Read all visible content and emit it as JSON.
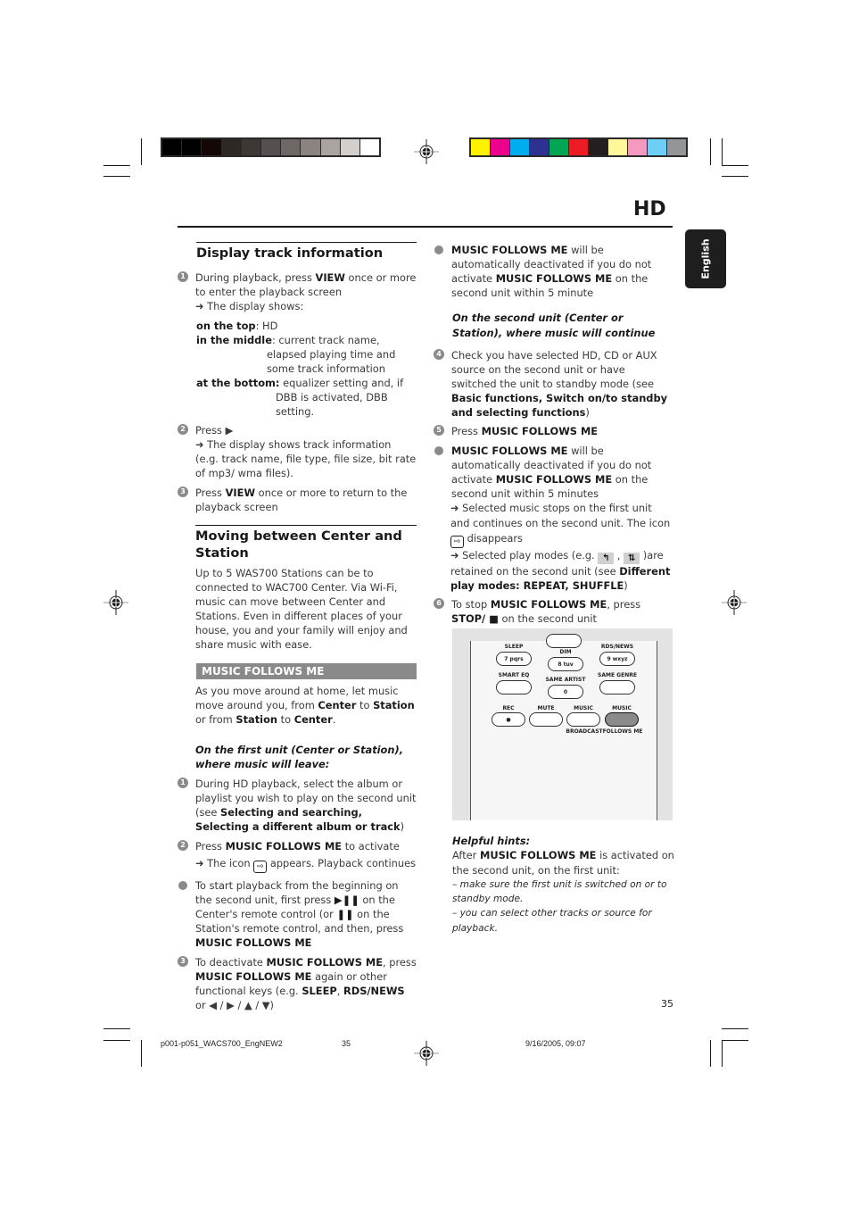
{
  "print_marks": {
    "grayscale_swatches": [
      "#000000",
      "#000000",
      "#140807",
      "#2d2826",
      "#3d3835",
      "#555050",
      "#6f6765",
      "#8b8380",
      "#a9a4a1",
      "#d3cfcd",
      "#ffffff"
    ],
    "color_swatches": [
      "#fff200",
      "#ec008c",
      "#00aeef",
      "#2e3192",
      "#00a651",
      "#ed1c24",
      "#231f20",
      "#fff799",
      "#f49ac1",
      "#6dcff6",
      "#939598"
    ]
  },
  "header": {
    "section_code": "HD",
    "language_tab": "English"
  },
  "left_column": {
    "display_track": {
      "heading": "Display track information",
      "step1": {
        "num": "1",
        "pre": "During playback, press ",
        "key": "VIEW",
        "post": " once or more to enter the playback screen",
        "result": "➜ The display shows:"
      },
      "on_top_label": "on the top",
      "on_top_value": ": HD",
      "middle_label": "in the middle",
      "middle_value": ": current track name, elapsed playing time and some track information",
      "bottom_label": "at the bottom:",
      "bottom_value": " equalizer setting and, if DBB is activated, DBB setting.",
      "step2": {
        "num": "2",
        "text": "Press ▶",
        "result": "➜ The display shows track information (e.g. track name, file type, file size, bit rate of mp3/ wma files)."
      },
      "step3": {
        "num": "3",
        "pre": "Press ",
        "key": "VIEW",
        "post": " once or more to return to the playback screen"
      }
    },
    "moving": {
      "heading": "Moving between Center and Station",
      "intro": "Up to 5 WAS700 Stations can be to connected to WAC700 Center. Via Wi-Fi,  music can move between Center and Stations. Even in different places of your house, you and your family will enjoy and share music with ease."
    },
    "mfm": {
      "banner": "MUSIC FOLLOWS ME",
      "intro_pre": "As you move around at home, let music move around you, from ",
      "center": "Center",
      "to": " to ",
      "station": "Station",
      "or_from": "  or from ",
      "intro_end": ".",
      "first_unit_heading": "On the first unit (Center or Station), where music will leave:",
      "step1": {
        "num": "1",
        "pre": "During HD playback, select the album or playlist you wish to play on the second unit (see ",
        "ref": "Selecting and searching, Selecting a different album or track",
        "post": ")"
      },
      "step2": {
        "num": "2",
        "pre": "Press ",
        "key": "MUSIC FOLLOWS ME",
        "post": " to activate",
        "result_pre": "➜ The icon ",
        "result_post": " appears. Playback continues"
      },
      "bullet": {
        "pre": "To start playback from the beginning on the second unit,  first press ",
        "k1": "▶❚❚",
        "mid": " on the Center's remote control (or ",
        "k2": "❚❚",
        "mid2": " on the Station's remote control, and then, press ",
        "key": "MUSIC FOLLOWS ME"
      },
      "step3": {
        "num": "3",
        "pre": "To deactivate ",
        "key": "MUSIC FOLLOWS ME",
        "mid": ", press ",
        "key2": "MUSIC FOLLOWS ME",
        "mid2": " again or other functional keys (e.g. ",
        "k3": "SLEEP",
        "comma": ", ",
        "k4": "RDS/NEWS",
        "end": " or  ◀ / ▶ / ▲ / ▼)"
      }
    }
  },
  "right_column": {
    "bullet1": {
      "key": "MUSIC FOLLOWS ME",
      "mid": " will be automatically deactivated if you do not activate ",
      "key2": "MUSIC FOLLOWS ME",
      "end": " on the second unit within 5 minute"
    },
    "second_unit_heading": "On the second unit (Center or Station), where music will continue",
    "step4": {
      "num": "4",
      "pre": "Check you have selected HD, CD or AUX source on the second unit or have switched the unit to standby mode (see ",
      "ref": "Basic functions, Switch on/to standby and selecting functions",
      "post": ")"
    },
    "step5": {
      "num": "5",
      "pre": "Press ",
      "key": "MUSIC FOLLOWS ME"
    },
    "bullet2": {
      "key": "MUSIC FOLLOWS ME",
      "mid": " will be automatically deactivated if you do not activate ",
      "key2": "MUSIC FOLLOWS ME",
      "end": " on the second unit within 5 minutes",
      "r1_pre": "➜ Selected music stops on the first unit and continues on the second unit.  The icon ",
      "r1_post": " disappears",
      "r2_pre": "➜ Selected play modes (e.g. ",
      "r2_mid": " ,  ",
      "r2_post": " )are retained on the second unit (see ",
      "ref": "Different play modes: REPEAT, SHUFFLE",
      "r2_end": ")"
    },
    "step6": {
      "num": "6",
      "pre": "To stop ",
      "key": "MUSIC FOLLOWS ME",
      "mid": ", press ",
      "key2": "STOP/ ■",
      "end": " on the second unit"
    },
    "remote": {
      "labels": {
        "sleep": "SLEEP",
        "dim": "DIM",
        "rds": "RDS/NEWS",
        "smart_eq": "SMART EQ",
        "same_artist": "SAME ARTIST",
        "same_genre": "SAME GENRE",
        "rec": "REC",
        "mute": "MUTE",
        "music": "MUSIC",
        "broadcast": "BROADCAST",
        "music2": "MUSIC",
        "follows_me": "FOLLOWS ME"
      },
      "keys": {
        "k7": "7 pqrs",
        "k8": "8 tuv",
        "k9": "9 wxyz",
        "k0": "0",
        "rec_dot": "●"
      }
    },
    "hints": {
      "heading": "Helpful hints:",
      "pre": "After ",
      "key": "MUSIC FOLLOWS ME",
      "post": " is activated on the second unit,  on the first unit:",
      "item1": "–  make sure the first unit is switched on or to standby mode.",
      "item2": "– you can select other tracks or source for playback."
    }
  },
  "page_number": "35",
  "footer": {
    "file": "p001-p051_WACS700_EngNEW2",
    "page": "35",
    "date": "9/16/2005, 09:07"
  }
}
